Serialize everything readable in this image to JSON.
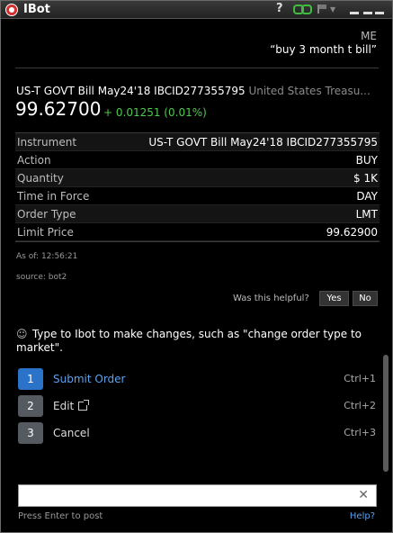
{
  "window": {
    "title": "IBot",
    "help_glyph": "?",
    "icons": [
      "app-logo-icon",
      "link-icon",
      "flag-icon",
      "minimize-icon",
      "maximize-icon",
      "close-icon"
    ]
  },
  "chat": {
    "sender": "ME",
    "message": "“buy 3 month t bill”"
  },
  "contract": {
    "title": "US-T GOVT Bill May24'18 IBCID277355795",
    "subtitle": "United States Treasu...",
    "price": "99.62700",
    "change": "+ 0.01251 (0.01%)",
    "change_color": "#4ec94e"
  },
  "order": {
    "rows": [
      {
        "label": "Instrument",
        "value": "US-T GOVT Bill May24'18 IBCID277355795"
      },
      {
        "label": "Action",
        "value": "BUY"
      },
      {
        "label": "Quantity",
        "value": "$ 1K"
      },
      {
        "label": "Time in Force",
        "value": "DAY"
      },
      {
        "label": "Order Type",
        "value": "LMT"
      },
      {
        "label": "Limit Price",
        "value": "99.62900"
      }
    ],
    "as_of": "As of: 12:56:21",
    "source": "source: bot2"
  },
  "feedback": {
    "question": "Was this helpful?",
    "yes": "Yes",
    "no": "No"
  },
  "hint": "Type to Ibot to make changes, such as \"change order type to market\".",
  "actions": [
    {
      "num": "1",
      "label": "Submit Order",
      "shortcut": "Ctrl+1"
    },
    {
      "num": "2",
      "label": "Edit",
      "shortcut": "Ctrl+2"
    },
    {
      "num": "3",
      "label": "Cancel",
      "shortcut": "Ctrl+3"
    }
  ],
  "input": {
    "value": "",
    "placeholder": "",
    "clear_glyph": "✕"
  },
  "footer": {
    "hint": "Press Enter to post",
    "help": "Help?"
  },
  "colors": {
    "accent": "#2a73c9",
    "link": "#5aa2f0",
    "positive": "#4ec94e"
  }
}
